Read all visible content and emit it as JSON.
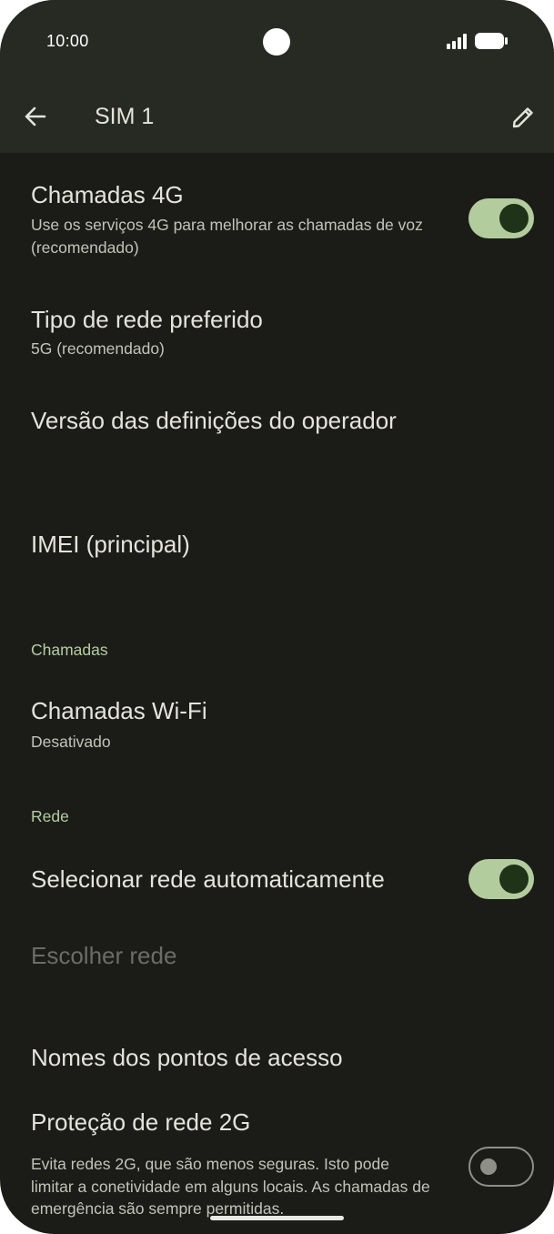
{
  "status_bar": {
    "time": "10:00",
    "icons": [
      "camera-cutout",
      "signal-icon",
      "battery-icon"
    ]
  },
  "app_bar": {
    "title": "SIM 1",
    "back_icon": "arrow-back-icon",
    "edit_icon": "pencil-icon"
  },
  "settings": {
    "volte": {
      "title": "Chamadas 4G",
      "subtitle": "Use os serviços 4G para melhorar as chamadas de voz (recomendado)",
      "toggle_on": true
    },
    "network_type": {
      "title": "Tipo de rede preferido",
      "subtitle": "5G (recomendado)"
    },
    "carrier_version": {
      "title": "Versão das definições do operador"
    },
    "imei": {
      "title": "IMEI (principal)"
    },
    "calls_section": "Chamadas",
    "wifi_calling": {
      "title": "Chamadas Wi-Fi",
      "subtitle": "Desativado"
    },
    "network_section": "Rede",
    "auto_network": {
      "title": "Selecionar rede automaticamente",
      "toggle_on": true
    },
    "choose_network": {
      "title": "Escolher rede",
      "enabled": false
    },
    "apn": {
      "title": "Nomes dos pontos de acesso"
    },
    "protection_2g": {
      "title": "Proteção de rede 2G",
      "subtitle": "Evita redes 2G, que são menos seguras. Isto pode limitar a conetividade em alguns locais. As chamadas de emergência são sempre permitidas.",
      "toggle_on": false
    }
  },
  "colors": {
    "background": "#1b1c18",
    "app_bar": "#272a22",
    "accent": "#b3cc9e",
    "text_primary": "#e4e3dc",
    "text_secondary": "#c2c3b8",
    "section_header": "#b3cda1"
  }
}
